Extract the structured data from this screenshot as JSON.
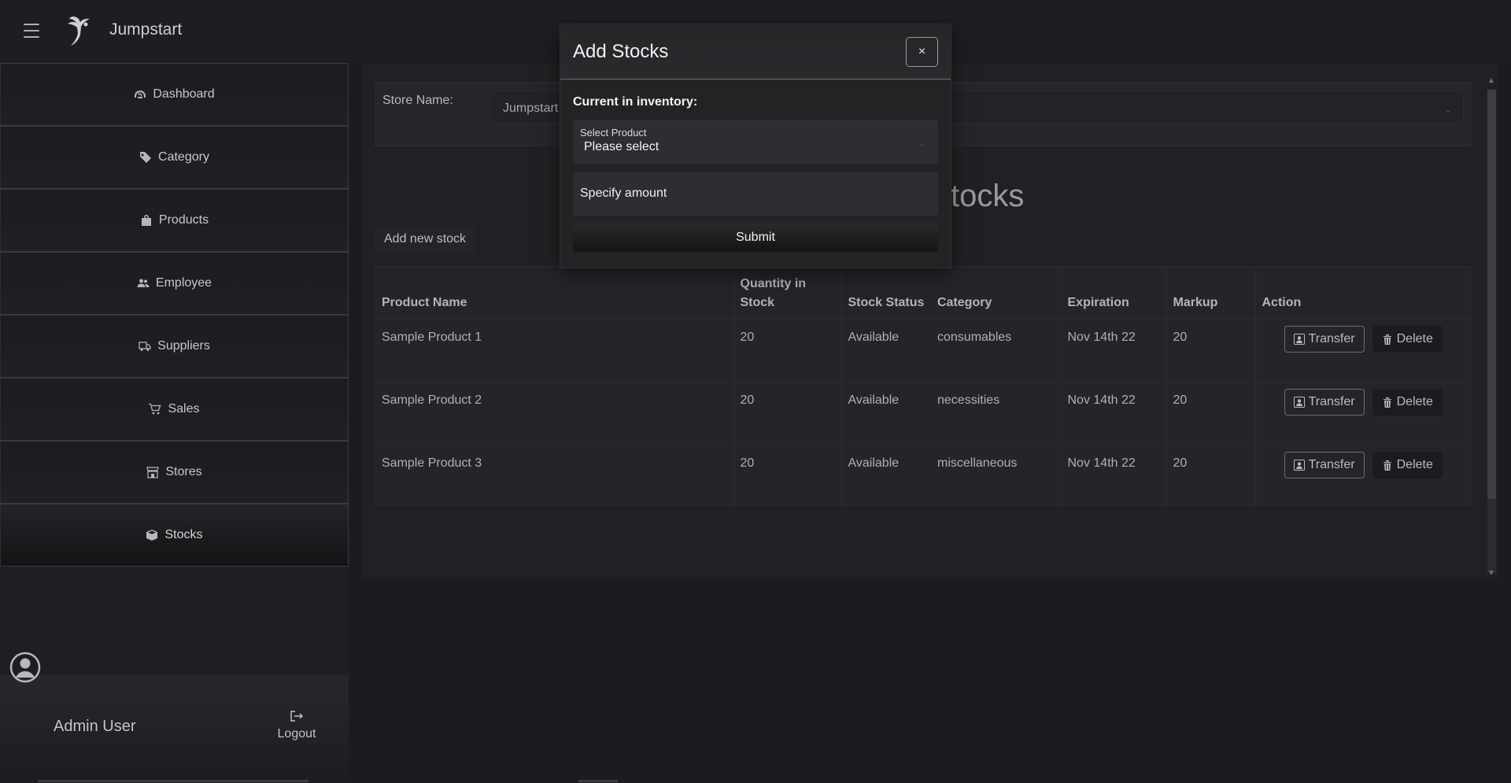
{
  "app": {
    "title": "Jumpstart"
  },
  "sidebar": {
    "items": [
      {
        "label": "Dashboard",
        "icon": "dashboard-icon"
      },
      {
        "label": "Category",
        "icon": "tag-icon"
      },
      {
        "label": "Products",
        "icon": "bag-icon"
      },
      {
        "label": "Employee",
        "icon": "people-icon"
      },
      {
        "label": "Suppliers",
        "icon": "truck-icon"
      },
      {
        "label": "Sales",
        "icon": "cart-icon"
      },
      {
        "label": "Stores",
        "icon": "store-icon"
      },
      {
        "label": "Stocks",
        "icon": "box-icon"
      }
    ],
    "active": "Stocks",
    "user_name": "Admin User",
    "logout_label": "Logout"
  },
  "main": {
    "store_label": "Store Name:",
    "store_value": "Jumpstart",
    "heading": "tocks",
    "add_button": "Add new stock",
    "columns": [
      "Product Name",
      "Quantity in Stock",
      "Stock Status",
      "Category",
      "Expiration",
      "Markup",
      "Action"
    ],
    "rows": [
      {
        "name": "Sample Product 1",
        "qty": "20",
        "status": "Available",
        "category": "consumables",
        "expiration": "Nov 14th 22",
        "markup": "20"
      },
      {
        "name": "Sample Product 2",
        "qty": "20",
        "status": "Available",
        "category": "necessities",
        "expiration": "Nov 14th 22",
        "markup": "20"
      },
      {
        "name": "Sample Product 3",
        "qty": "20",
        "status": "Available",
        "category": "miscellaneous",
        "expiration": "Nov 14th 22",
        "markup": "20"
      }
    ],
    "transfer_label": "Transfer",
    "delete_label": "Delete"
  },
  "modal": {
    "title": "Add Stocks",
    "close_label": "×",
    "inventory_label": "Current in inventory:",
    "select_label": "Select Product",
    "select_value": "Please select",
    "amount_placeholder": "Specify amount",
    "submit_label": "Submit"
  }
}
